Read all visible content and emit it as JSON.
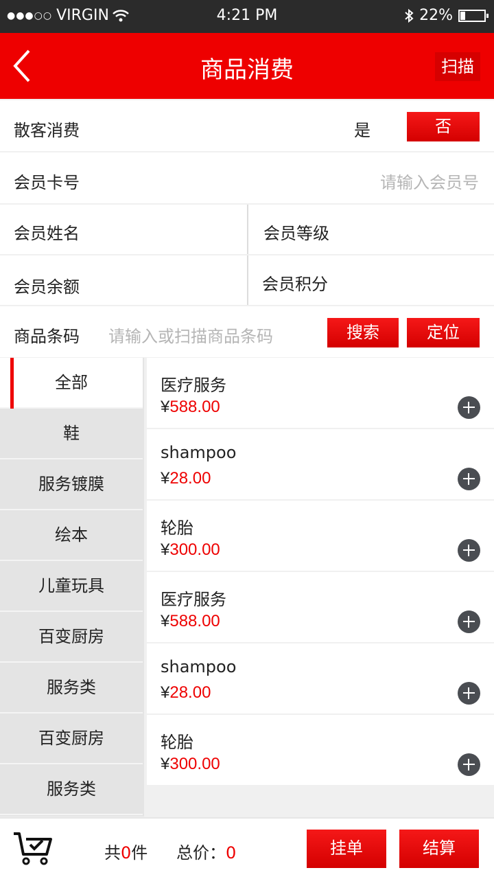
{
  "status": {
    "carrier": "VIRGIN",
    "time": "4:21 PM",
    "battery": "22%",
    "battery_level": 0.22
  },
  "nav": {
    "title": "商品消费",
    "scan_label": "扫描"
  },
  "form": {
    "walkin_label": "散客消费",
    "yes_label": "是",
    "no_label": "否",
    "card_label": "会员卡号",
    "card_placeholder": "请输入会员号",
    "name_label": "会员姓名",
    "level_label": "会员等级",
    "balance_label": "会员余额",
    "points_label": "会员积分",
    "barcode_label": "商品条码",
    "barcode_placeholder": "请输入或扫描商品条码",
    "search_label": "搜索",
    "locate_label": "定位"
  },
  "categories": [
    "全部",
    "鞋",
    "服务镀膜",
    "绘本",
    "儿童玩具",
    "百变厨房",
    "服务类",
    "百变厨房",
    "服务类"
  ],
  "products": [
    {
      "name": "医疗服务",
      "currency": "¥",
      "price": "588.00"
    },
    {
      "name": "shampoo",
      "currency": "¥",
      "price": "28.00"
    },
    {
      "name": "轮胎",
      "currency": "¥",
      "price": "300.00"
    },
    {
      "name": "医疗服务",
      "currency": "¥",
      "price": "588.00"
    },
    {
      "name": "shampoo",
      "currency": "¥",
      "price": "28.00"
    },
    {
      "name": "轮胎",
      "currency": "¥",
      "price": "300.00"
    }
  ],
  "footer": {
    "count_prefix": "共",
    "count_value": "0",
    "count_suffix": "件",
    "total_label": "总价：",
    "total_value": "0",
    "hold_label": "挂单",
    "settle_label": "结算"
  },
  "colors": {
    "brand": "#ee0000",
    "statusbar": "#2b2b2b"
  }
}
